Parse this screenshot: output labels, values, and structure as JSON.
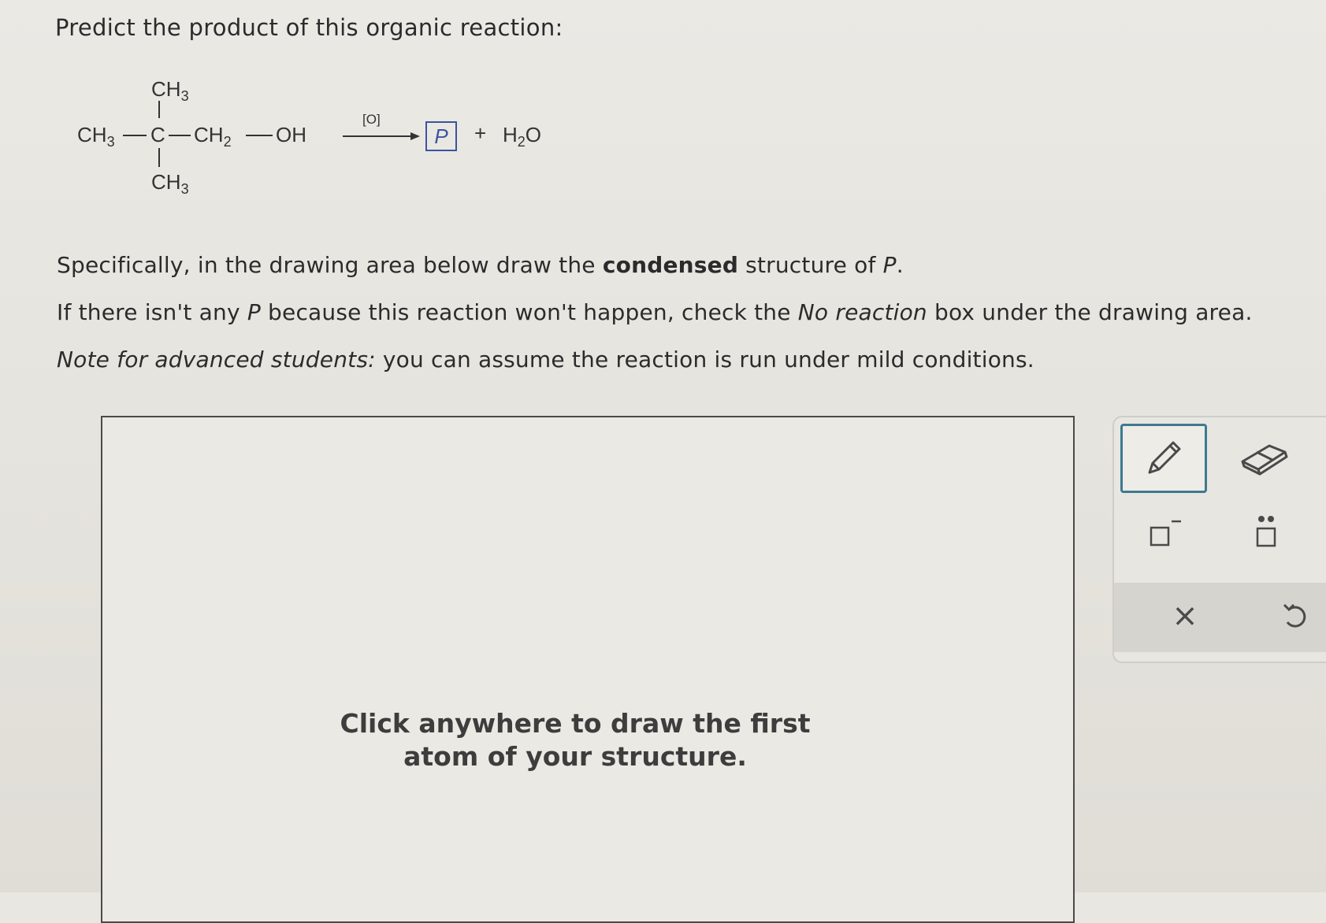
{
  "question": {
    "prompt": "Predict the product of this organic reaction:",
    "instruction_parts": [
      "Specifically, in the drawing area below draw the ",
      "condensed",
      " structure of ",
      "P",
      "."
    ],
    "no_reaction_parts": [
      "If there isn't any ",
      "P",
      " because this reaction won't happen, check the ",
      "No reaction",
      " box under the drawing area."
    ],
    "note_parts": [
      "Note for advanced students:",
      " you can assume the reaction is run under mild conditions."
    ]
  },
  "reaction": {
    "top_group": "CH3",
    "left_group": "CH3",
    "center_atom": "C",
    "chain_group": "CH2",
    "hydroxyl": "OH",
    "bottom_group": "CH3",
    "reagent": "[O]",
    "product_label": "P",
    "plus": "+",
    "byproduct": "H2O"
  },
  "drawing_area": {
    "hint_line1": "Click anywhere to draw the first",
    "hint_line2": "atom of your structure."
  },
  "toolbar": {
    "tools": [
      {
        "name": "pencil-icon",
        "active": true
      },
      {
        "name": "eraser-icon",
        "active": false
      },
      {
        "name": "charge-icon",
        "label": "−"
      },
      {
        "name": "lone-pair-icon",
        "label": "••"
      },
      {
        "name": "clear-icon",
        "label": "×"
      },
      {
        "name": "undo-icon",
        "label": "↺"
      }
    ]
  },
  "colors": {
    "accent": "#3d7a8f",
    "product_box": "#3a55a0"
  }
}
